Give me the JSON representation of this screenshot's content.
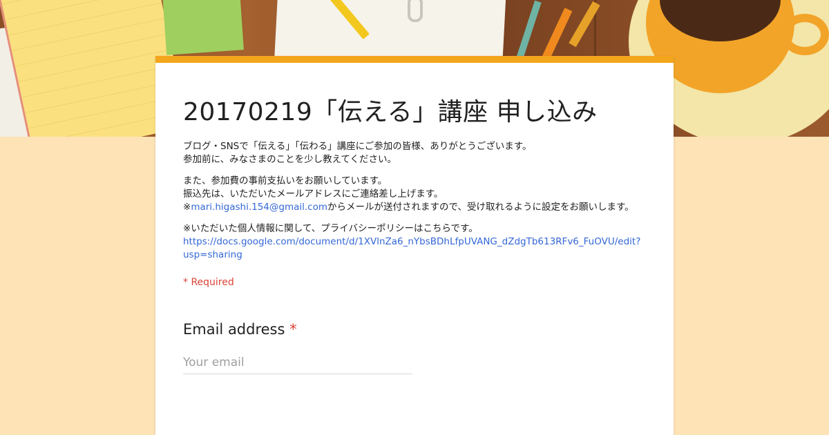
{
  "form": {
    "title": "20170219「伝える」講座 申し込み",
    "description": {
      "p1_line1": "ブログ・SNSで「伝える」「伝わる」講座にご参加の皆様、ありがとうございます。",
      "p1_line2": "参加前に、みなさまのことを少し教えてください。",
      "p2_line1": "また、参加費の事前支払いをお願いしています。",
      "p2_line2": "振込先は、いただいたメールアドレスにご連絡差し上げます。",
      "p2_prefix": "※",
      "p2_email": "mari.higashi.154@gmail.com",
      "p2_suffix": "からメールが送付されますので、受け取れるように設定をお願いします。",
      "p3_line1": "※いただいた個人情報に関して、プライバシーポリシーはこちらです。",
      "p3_link": "https://docs.google.com/document/d/1XVlnZa6_nYbsBDhLfpUVANG_dZdgTb613RFv6_FuOVU/edit?usp=sharing"
    },
    "required_note": "* Required",
    "email_question": {
      "label": "Email address",
      "required_mark": "*",
      "placeholder": "Your email"
    }
  },
  "colors": {
    "page_background": "#fde3b6",
    "card_accent": "#f3a51c",
    "required_red": "#db4437",
    "link_blue": "#3367d6"
  }
}
